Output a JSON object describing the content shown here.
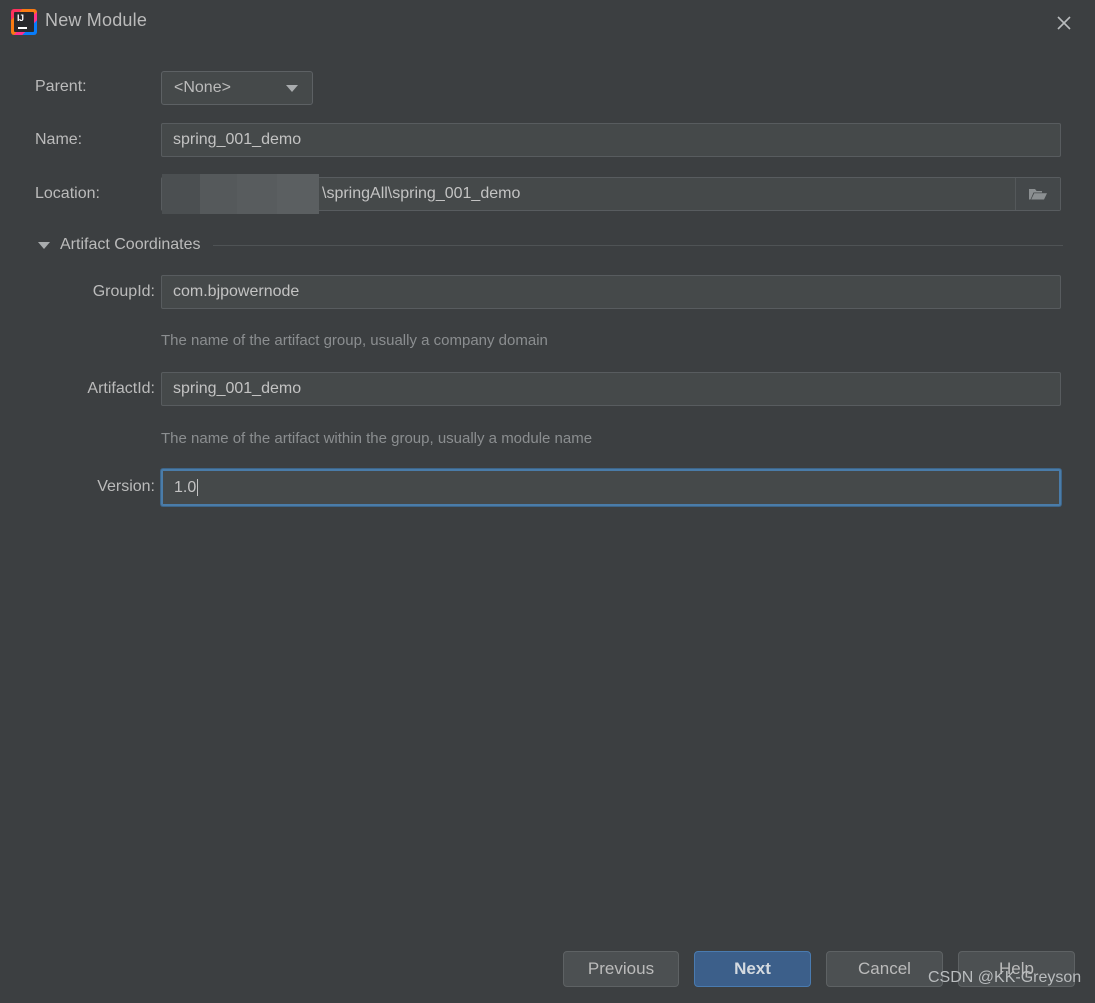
{
  "window": {
    "title": "New Module",
    "logo_icon": "intellij-idea-logo",
    "close_icon": "close-icon"
  },
  "form": {
    "parent": {
      "label": "Parent:",
      "value": "<None>",
      "chevron_icon": "chevron-down-icon"
    },
    "name": {
      "label": "Name:",
      "value": "spring_001_demo"
    },
    "location": {
      "label": "Location:",
      "value": "\\springAll\\spring_001_demo",
      "redacted": true,
      "browse_icon": "folder-open-icon"
    }
  },
  "artifact_section": {
    "title": "Artifact Coordinates",
    "expanded": true,
    "disclosure_icon": "triangle-down-icon",
    "group_id": {
      "label": "GroupId:",
      "value": "com.bjpowernode",
      "hint": "The name of the artifact group, usually a company domain"
    },
    "artifact_id": {
      "label": "ArtifactId:",
      "value": "spring_001_demo",
      "hint": "The name of the artifact within the group, usually a module name"
    },
    "version": {
      "label": "Version:",
      "value": "1.0",
      "focused": true
    }
  },
  "buttons": {
    "previous": "Previous",
    "next": "Next",
    "cancel": "Cancel",
    "help": "Help"
  },
  "watermark": "CSDN @KK-Greyson",
  "colors": {
    "background": "#3c3f41",
    "field_background": "#45494a",
    "field_border": "#585c5f",
    "focus_border": "#4a7ca9",
    "primary_button": "#3c5f8a",
    "label_text": "#bbbbbb",
    "hint_text": "#8b8e90"
  }
}
